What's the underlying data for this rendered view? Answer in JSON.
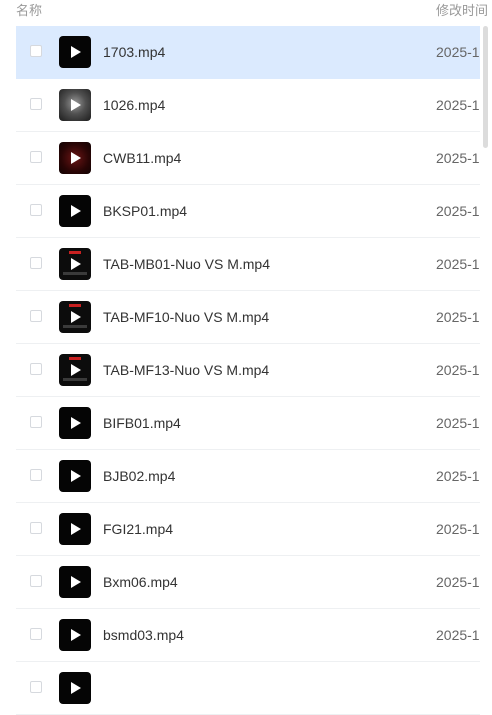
{
  "header": {
    "name_label": "名称",
    "time_label": "修改时间"
  },
  "files": [
    {
      "name": "1703.mp4",
      "date": "2025-1",
      "thumb": "black",
      "selected": true
    },
    {
      "name": "1026.mp4",
      "date": "2025-1",
      "thumb": "grey",
      "selected": false
    },
    {
      "name": "CWB11.mp4",
      "date": "2025-1",
      "thumb": "red",
      "selected": false
    },
    {
      "name": "BKSP01.mp4",
      "date": "2025-1",
      "thumb": "black",
      "selected": false
    },
    {
      "name": "TAB-MB01-Nuo VS M.mp4",
      "date": "2025-1",
      "thumb": "logo",
      "selected": false
    },
    {
      "name": "TAB-MF10-Nuo VS M.mp4",
      "date": "2025-1",
      "thumb": "logo",
      "selected": false
    },
    {
      "name": "TAB-MF13-Nuo VS M.mp4",
      "date": "2025-1",
      "thumb": "logo",
      "selected": false
    },
    {
      "name": "BIFB01.mp4",
      "date": "2025-1",
      "thumb": "black",
      "selected": false
    },
    {
      "name": "BJB02.mp4",
      "date": "2025-1",
      "thumb": "black",
      "selected": false
    },
    {
      "name": "FGI21.mp4",
      "date": "2025-1",
      "thumb": "black",
      "selected": false
    },
    {
      "name": "Bxm06.mp4",
      "date": "2025-1",
      "thumb": "black",
      "selected": false
    },
    {
      "name": "bsmd03.mp4",
      "date": "2025-1",
      "thumb": "black",
      "selected": false
    },
    {
      "name": "",
      "date": "",
      "thumb": "black",
      "selected": false
    }
  ],
  "colors": {
    "selected_row": "#dbeafe",
    "divider": "#eef0f2"
  }
}
